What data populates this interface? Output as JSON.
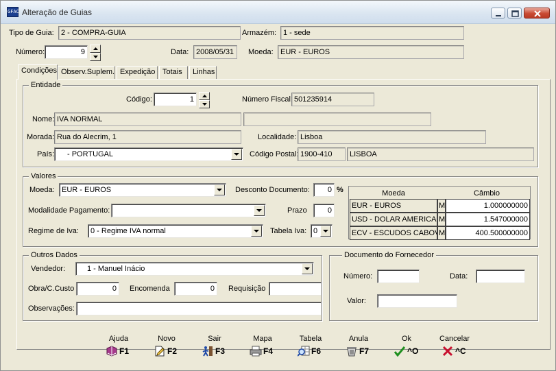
{
  "window": {
    "title": "Alteração de Guias",
    "app_icon_text": "GFAC"
  },
  "header": {
    "tipo_guia_label": "Tipo de Guia:",
    "tipo_guia_value": "2 - COMPRA-GUIA",
    "armazem_label": "Armazém:",
    "armazem_value": "1 - sede",
    "numero_label": "Número:",
    "numero_value": "9",
    "data_label": "Data:",
    "data_value": "2008/05/31",
    "moeda_label": "Moeda:",
    "moeda_value": "EUR - EUROS"
  },
  "tabs": [
    {
      "label": "Condições"
    },
    {
      "label": "Observ.Suplem."
    },
    {
      "label": "Expedição"
    },
    {
      "label": "Totais"
    },
    {
      "label": "Linhas"
    }
  ],
  "entidade": {
    "title": "Entidade",
    "codigo_label": "Código:",
    "codigo_value": "1",
    "nif_label": "Número Fiscal:",
    "nif_value": "501235914",
    "nome_label": "Nome:",
    "nome_value": "IVA NORMAL",
    "nome2_value": "",
    "morada_label": "Morada:",
    "morada_value": "Rua do Alecrim, 1",
    "localidade_label": "Localidade:",
    "localidade_value": "Lisboa",
    "pais_label": "País:",
    "pais_value": "- PORTUGAL",
    "cp_label": "Código Postal:",
    "cp_value": "1900-410",
    "cp_local_value": "LISBOA"
  },
  "valores": {
    "title": "Valores",
    "moeda_label": "Moeda:",
    "moeda_value": "EUR - EUROS",
    "desconto_label": "Desconto Documento:",
    "desconto_value": "0",
    "percent_sign": "%",
    "modalidade_label": "Modalidade Pagamento:",
    "modalidade_value": "",
    "prazo_label": "Prazo",
    "prazo_value": "0",
    "regime_label": "Regime de Iva:",
    "regime_value": "0 - Regime IVA normal",
    "tabela_label": "Tabela Iva:",
    "tabela_value": "0",
    "grid": {
      "col_moeda": "Moeda",
      "col_cambio": "Câmbio",
      "rows": [
        {
          "moeda": "EUR - EUROS",
          "flag": "M",
          "cambio": "1.000000000"
        },
        {
          "moeda": "USD - DOLAR AMERICANO",
          "flag": "M",
          "cambio": "1.547000000"
        },
        {
          "moeda": "ECV - ESCUDOS CABOVERDIANOS",
          "flag": "M",
          "cambio": "400.500000000"
        }
      ]
    }
  },
  "outros": {
    "title": "Outros Dados",
    "vendedor_label": "Vendedor:",
    "vendedor_value": "1 - Manuel Inácio",
    "obra_label": "Obra/C.Custo",
    "obra_value": "0",
    "encomenda_label": "Encomenda",
    "encomenda_value": "0",
    "requisicao_label": "Requisição",
    "requisicao_value": "",
    "obs_label": "Observações:",
    "obs_value": ""
  },
  "fornecedor": {
    "title": "Documento do Fornecedor",
    "numero_label": "Número:",
    "numero_value": "",
    "data_label": "Data:",
    "data_value": "",
    "valor_label": "Valor:",
    "valor_value": ""
  },
  "toolbar": [
    {
      "label": "Ajuda",
      "key": "F1",
      "icon": "book-icon"
    },
    {
      "label": "Novo",
      "key": "F2",
      "icon": "new-document-icon"
    },
    {
      "label": "Sair",
      "key": "F3",
      "icon": "exit-person-icon"
    },
    {
      "label": "Mapa",
      "key": "F4",
      "icon": "printer-icon"
    },
    {
      "label": "Tabela",
      "key": "F6",
      "icon": "table-search-icon"
    },
    {
      "label": "Anula",
      "key": "F7",
      "icon": "trash-icon"
    },
    {
      "label": "Ok",
      "key": "^O",
      "icon": "checkmark-icon"
    },
    {
      "label": "Cancelar",
      "key": "^C",
      "icon": "cancel-x-icon"
    }
  ],
  "colors": {
    "window_bg": "#ece9d8",
    "ok_green": "#1f8f1f",
    "cancel_red": "#c8102e"
  }
}
